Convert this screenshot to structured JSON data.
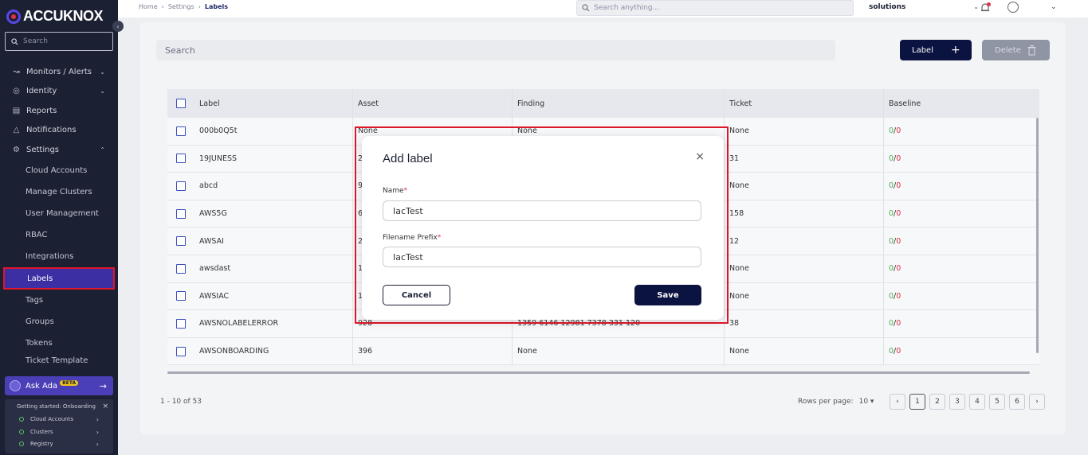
{
  "brand": {
    "name": "ACCUKNOX"
  },
  "sidebar": {
    "search_placeholder": "Search",
    "items": [
      {
        "label": "Monitors / Alerts",
        "icon": "chart-line-icon"
      },
      {
        "label": "Identity",
        "icon": "fingerprint-icon"
      },
      {
        "label": "Reports",
        "icon": "clipboard-icon"
      },
      {
        "label": "Notifications",
        "icon": "bell-icon"
      },
      {
        "label": "Settings",
        "icon": "gear-icon"
      }
    ],
    "sub_items": [
      "Cloud Accounts",
      "Manage Clusters",
      "User Management",
      "RBAC",
      "Integrations",
      "Labels",
      "Tags",
      "Groups",
      "Tokens",
      "Ticket Template"
    ],
    "ask_ada": {
      "label": "Ask Ada",
      "badge": "BETA"
    },
    "onboarding": {
      "title": "Getting started: Onboarding",
      "steps": [
        "Cloud Accounts",
        "Clusters",
        "Registry"
      ]
    }
  },
  "topbar": {
    "breadcrumb": [
      "Home",
      "Settings",
      "Labels"
    ],
    "search_placeholder": "Search anything...",
    "tenant": "solutions"
  },
  "main": {
    "search_placeholder": "Search",
    "label_button": "Label",
    "delete_button": "Delete",
    "columns": [
      "Label",
      "Asset",
      "Finding",
      "Ticket",
      "Baseline"
    ],
    "rows": [
      {
        "label": "000b0Q5t",
        "asset": "None",
        "finding": "None",
        "ticket": "None",
        "baseline_g": "0",
        "baseline_r": "0"
      },
      {
        "label": "19JUNESS",
        "asset": "2",
        "finding": "",
        "ticket": "31",
        "baseline_g": "0",
        "baseline_r": "0"
      },
      {
        "label": "abcd",
        "asset": "9",
        "finding": "",
        "ticket": "None",
        "baseline_g": "0",
        "baseline_r": "0"
      },
      {
        "label": "AWS5G",
        "asset": "6",
        "finding": "",
        "ticket": "158",
        "baseline_g": "0",
        "baseline_r": "0"
      },
      {
        "label": "AWSAI",
        "asset": "2",
        "finding": "",
        "ticket": "12",
        "baseline_g": "0",
        "baseline_r": "0"
      },
      {
        "label": "awsdast",
        "asset": "1",
        "finding": "",
        "ticket": "None",
        "baseline_g": "0",
        "baseline_r": "0"
      },
      {
        "label": "AWSIAC",
        "asset": "1",
        "finding": "",
        "ticket": "None",
        "baseline_g": "0",
        "baseline_r": "0"
      },
      {
        "label": "AWSNOLABELERROR",
        "asset": "928",
        "finding": "1359  6146  12981  7378  331  120",
        "ticket": "38",
        "baseline_g": "0",
        "baseline_r": "0"
      },
      {
        "label": "AWSONBOARDING",
        "asset": "396",
        "finding": "None",
        "ticket": "None",
        "baseline_g": "0",
        "baseline_r": "0"
      }
    ],
    "count_text": "1 - 10 of 53",
    "rows_per_page_label": "Rows per page:",
    "rows_per_page": "10",
    "pages": [
      "1",
      "2",
      "3",
      "4",
      "5",
      "6"
    ]
  },
  "modal": {
    "title": "Add label",
    "name_label": "Name",
    "name_value": "IacTest",
    "prefix_label": "Filename Prefix",
    "prefix_value": "IacTest",
    "cancel": "Cancel",
    "save": "Save"
  },
  "colors": {
    "brand_navy": "#0b1340",
    "sidebar_bg": "#1c2033",
    "active_item": "#3b2fa3",
    "highlight": "#e0162b"
  }
}
